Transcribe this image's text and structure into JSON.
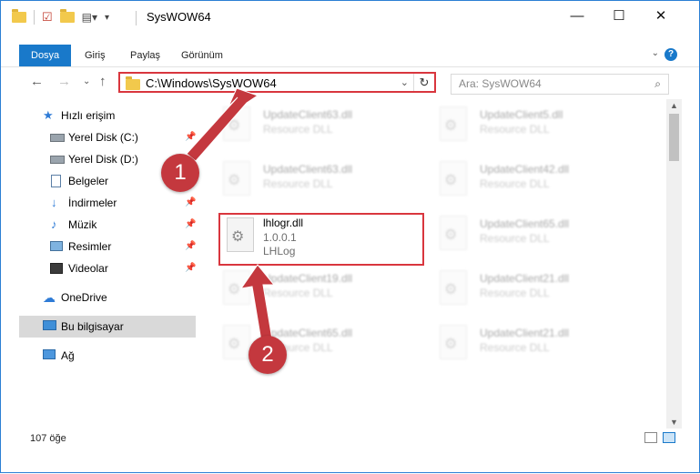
{
  "window": {
    "title": "SysWOW64",
    "minimize": "—",
    "maximize": "☐",
    "close": "✕"
  },
  "ribbon": {
    "tabs": [
      "Dosya",
      "Giriş",
      "Paylaş",
      "Görünüm"
    ],
    "help": "?",
    "collapse": "⌄"
  },
  "address": {
    "back": "←",
    "forward": "→",
    "recent": "⌄",
    "up": "↑",
    "path": "C:\\Windows\\SysWOW64",
    "dropdown": "⌄",
    "refresh": "↻",
    "search_placeholder": "Ara: SysWOW64",
    "search_icon": "⌕"
  },
  "sidebar": {
    "items": [
      {
        "label": "Hızlı erişim",
        "icon": "star-icon",
        "pinned": false
      },
      {
        "label": "Yerel Disk (C:)",
        "icon": "drive-icon",
        "pinned": true
      },
      {
        "label": "Yerel Disk (D:)",
        "icon": "drive-icon",
        "pinned": true
      },
      {
        "label": "Belgeler",
        "icon": "document-icon",
        "pinned": true
      },
      {
        "label": "İndirmeler",
        "icon": "download-icon",
        "pinned": true
      },
      {
        "label": "Müzik",
        "icon": "music-icon",
        "pinned": true
      },
      {
        "label": "Resimler",
        "icon": "pictures-icon",
        "pinned": true
      },
      {
        "label": "Videolar",
        "icon": "video-icon",
        "pinned": true
      },
      {
        "label": "OneDrive",
        "icon": "cloud-icon",
        "pinned": false
      },
      {
        "label": "Bu bilgisayar",
        "icon": "computer-icon",
        "pinned": false
      },
      {
        "label": "Ağ",
        "icon": "network-icon",
        "pinned": false
      }
    ],
    "pin_glyph": "📌"
  },
  "files": {
    "left": [
      {
        "name": "UpdateClient63.dll",
        "desc": "Resource DLL"
      },
      {
        "name": "UpdateClient63.dll",
        "desc": "Resource DLL"
      },
      {
        "name": "lhlogr.dll",
        "desc": "1.0.0.1",
        "desc2": "LHLog"
      },
      {
        "name": "UpdateClient19.dll",
        "desc": "Resource DLL"
      },
      {
        "name": "UpdateClient65.dll",
        "desc": "Resource DLL"
      }
    ],
    "right": [
      {
        "name": "UpdateClient5.dll",
        "desc": "Resource DLL"
      },
      {
        "name": "UpdateClient42.dll",
        "desc": "Resource DLL"
      },
      {
        "name": "UpdateClient65.dll",
        "desc": "Resource DLL"
      },
      {
        "name": "UpdateClient21.dll",
        "desc": "Resource DLL"
      },
      {
        "name": "UpdateClient21.dll",
        "desc": "Resource DLL"
      }
    ]
  },
  "status": {
    "count": "107 öğe"
  },
  "annotations": {
    "step1": "1",
    "step2": "2",
    "color": "#c4383e"
  },
  "colors": {
    "accent": "#1979ca",
    "highlight_border": "#d9363e"
  }
}
